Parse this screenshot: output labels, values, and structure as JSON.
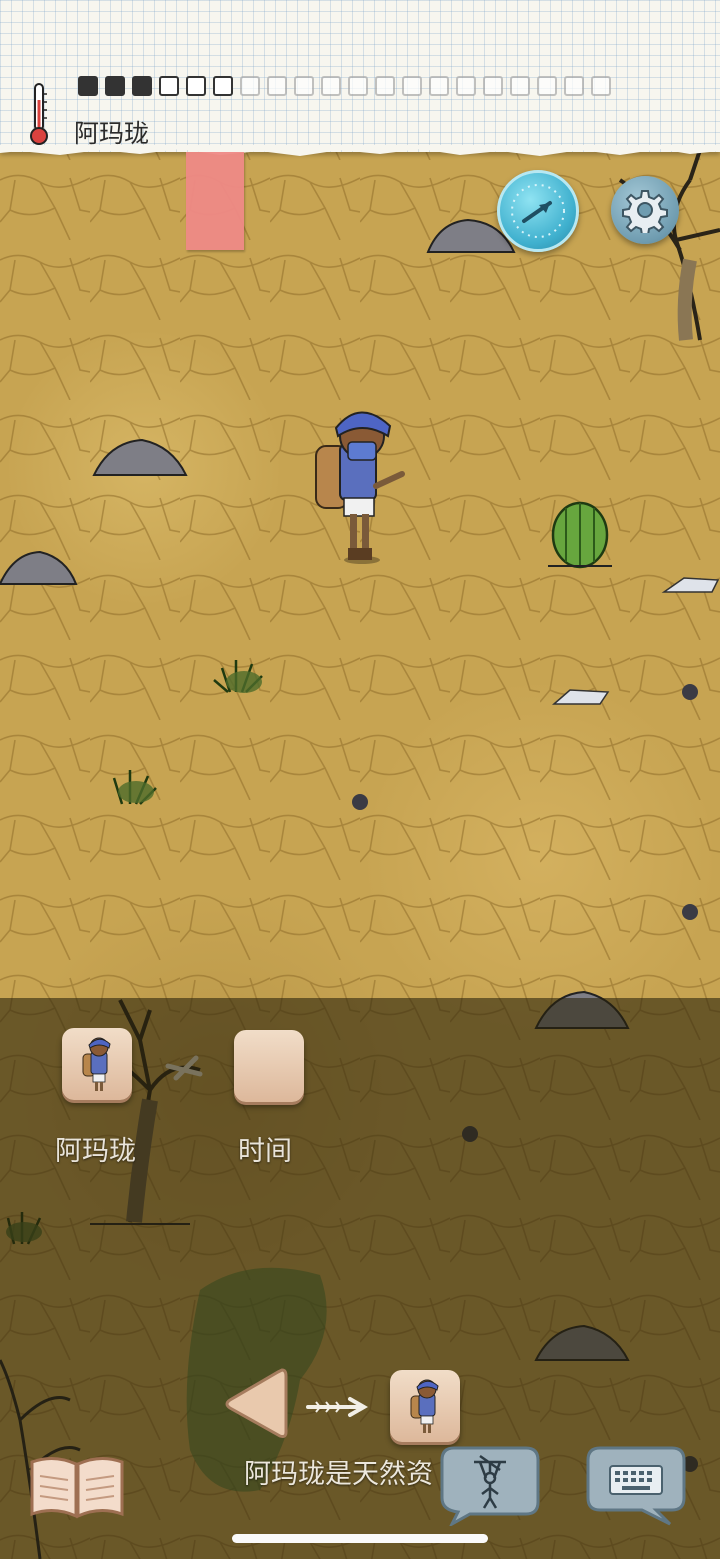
{
  "status_bar": {
    "location": "阿玛珑",
    "thermometer_icon": "thermometer-icon",
    "time_slots": [
      "filled",
      "filled",
      "filled",
      "empty",
      "empty",
      "empty",
      "faded",
      "faded",
      "faded",
      "faded",
      "faded",
      "faded",
      "faded",
      "faded",
      "faded",
      "faded",
      "faded",
      "faded",
      "faded",
      "faded"
    ]
  },
  "controls": {
    "compass_icon": "compass-icon",
    "settings_icon": "gear-icon"
  },
  "panel": {
    "cards": [
      {
        "label": "阿玛珑",
        "icon": "character-portrait"
      },
      {
        "label": "时间",
        "icon": "blank-card"
      }
    ],
    "sentence": {
      "text": "阿玛珑是天然资",
      "subject_icon": "character-portrait"
    }
  },
  "bottom_bar": {
    "journal_icon": "open-book-icon",
    "puppet_icon": "puppet-icon",
    "keyboard_icon": "keyboard-icon"
  },
  "colors": {
    "ground": "#c7a452",
    "paper": "#f7f6ef",
    "tab": "#ef8a86",
    "compass": "#3fb0ce",
    "card": "#e8c9ae"
  }
}
